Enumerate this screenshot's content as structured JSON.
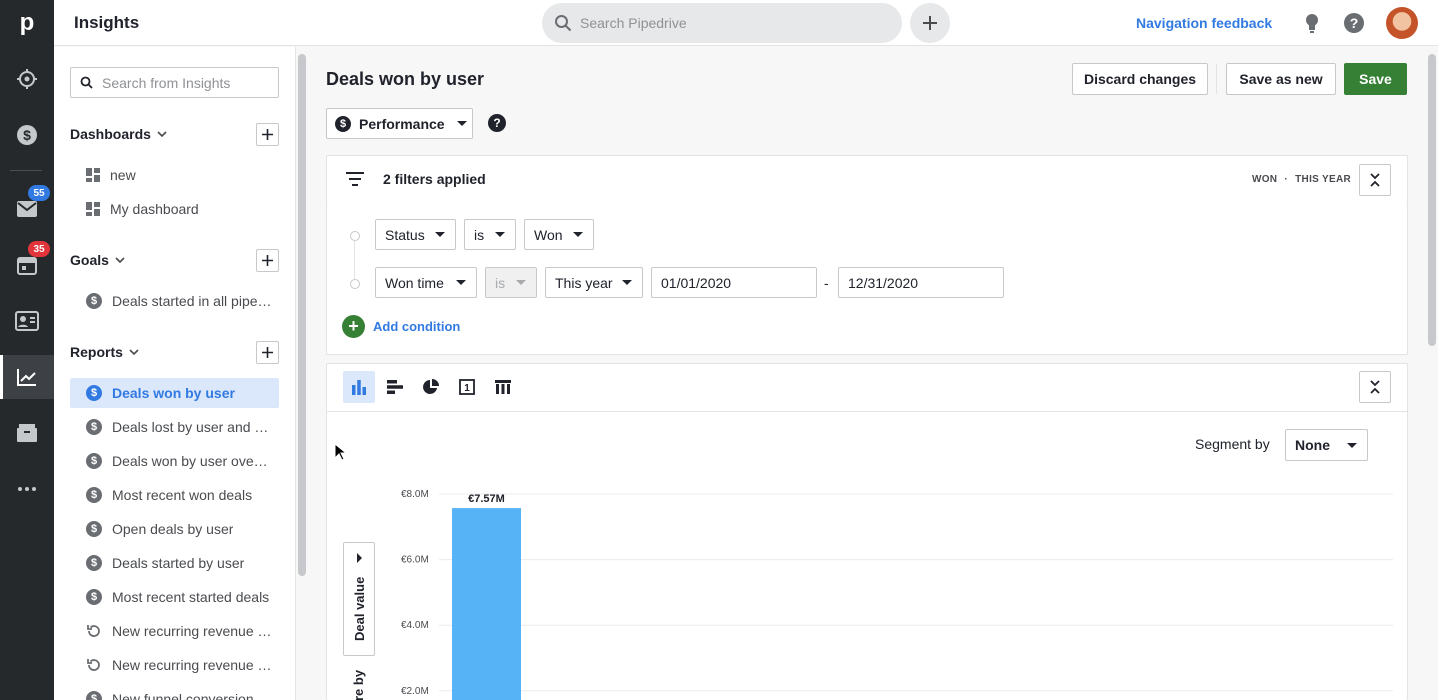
{
  "app": {
    "title": "Insights",
    "logo_letter": "p",
    "nav_feedback": "Navigation feedback",
    "search_placeholder": "Search Pipedrive"
  },
  "rail": {
    "items": [
      {
        "icon": "target-icon"
      },
      {
        "icon": "dollar-icon"
      },
      {
        "icon": "mail-icon",
        "badge": "55",
        "badge_color": "#317ae2"
      },
      {
        "icon": "calendar-icon",
        "badge": "35",
        "badge_color": "#e1343b"
      },
      {
        "icon": "contacts-icon"
      },
      {
        "icon": "insights-chart-icon",
        "active": true
      },
      {
        "icon": "products-box-icon"
      },
      {
        "icon": "more-icon"
      }
    ]
  },
  "sidebar": {
    "search_placeholder": "Search from Insights",
    "dashboards": {
      "label": "Dashboards",
      "items": [
        "new",
        "My dashboard"
      ]
    },
    "goals": {
      "label": "Goals",
      "items": [
        "Deals started in all pipelines"
      ]
    },
    "reports": {
      "label": "Reports",
      "items": [
        "Deals won by user",
        "Deals lost by user and reason",
        "Deals won by user over time",
        "Most recent won deals",
        "Open deals by user",
        "Deals started by user",
        "Most recent started deals",
        "New recurring revenue by user",
        "New recurring revenue over time",
        "New funnel conversion"
      ],
      "active_index": 0
    }
  },
  "header": {
    "title": "Deals won by user",
    "discard_label": "Discard changes",
    "save_new_label": "Save as new",
    "save_label": "Save",
    "report_type": "Performance"
  },
  "filters": {
    "summary": "2 filters applied",
    "tags": [
      "WON",
      "THIS YEAR"
    ],
    "rows": [
      {
        "field": "Status",
        "operator": "is",
        "value": "Won"
      },
      {
        "field": "Won time",
        "operator": "is",
        "value": "This year",
        "from": "01/01/2020",
        "to": "12/31/2020",
        "separator": "-"
      }
    ],
    "add_condition": "Add condition"
  },
  "chart_controls": {
    "segment_label": "Segment by",
    "segment_value": "None",
    "y_measure": "Deal value",
    "y_measure_2": "re by"
  },
  "chart_data": {
    "type": "bar",
    "ylabel": "Deal value",
    "ytick_labels": [
      "€8.0M",
      "€6.0M",
      "€4.0M",
      "€2.0M"
    ],
    "yticks": [
      8.0,
      6.0,
      4.0,
      2.0
    ],
    "values": [
      7.57
    ],
    "data_labels": [
      "€7.57M"
    ],
    "bar_color": "#56b3f5",
    "ylim": [
      0,
      8.0
    ],
    "grid": true
  },
  "colors": {
    "accent": "#317ae2",
    "primary_green": "#368036",
    "rail_bg": "#26292c"
  }
}
